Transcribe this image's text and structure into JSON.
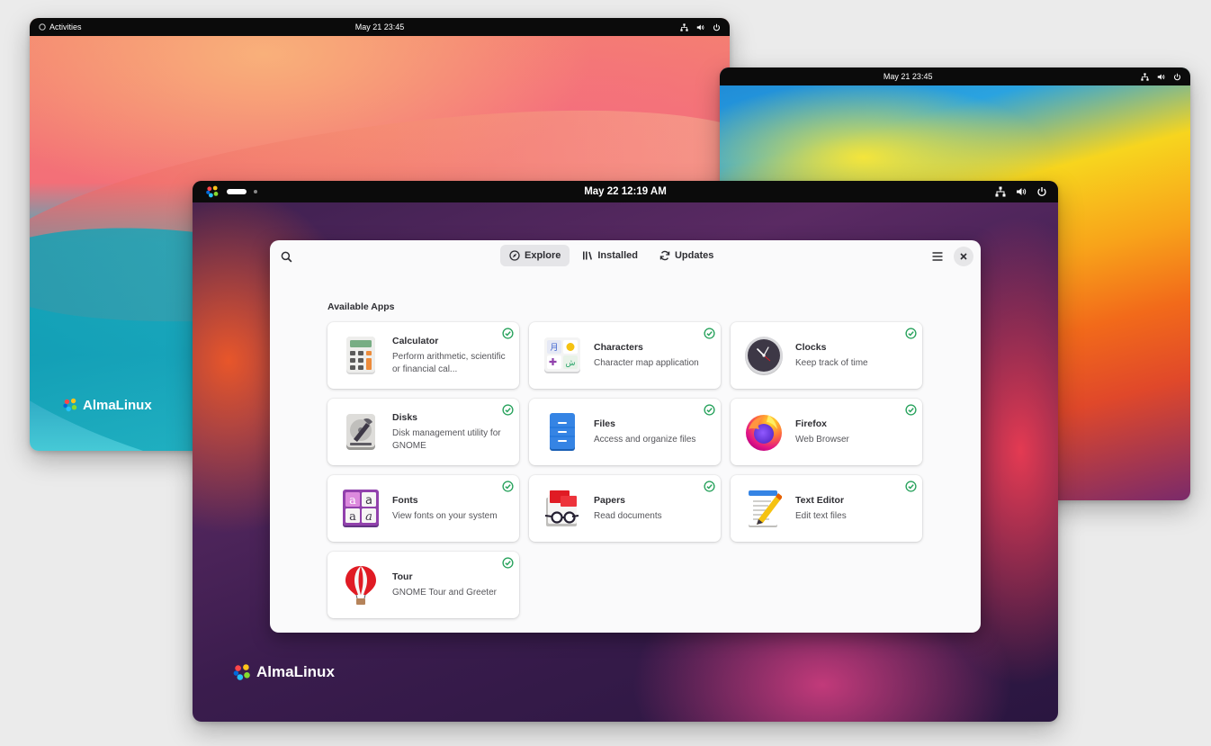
{
  "screens": {
    "left": {
      "activities_label": "Activities",
      "clock": "May 21  23:45",
      "logo_text": "AlmaLinux"
    },
    "right": {
      "clock": "May 21  23:45"
    },
    "main": {
      "clock": "May 22  12:19 AM",
      "logo_text": "AlmaLinux"
    }
  },
  "software": {
    "tabs": [
      {
        "label": "Explore",
        "icon": "compass-icon",
        "active": true
      },
      {
        "label": "Installed",
        "icon": "library-icon",
        "active": false
      },
      {
        "label": "Updates",
        "icon": "refresh-icon",
        "active": false
      }
    ],
    "section_title": "Available Apps",
    "apps": [
      {
        "name": "Calculator",
        "desc": "Perform arithmetic, scientific or financial cal...",
        "icon": "calculator-icon",
        "installed": true
      },
      {
        "name": "Characters",
        "desc": "Character map application",
        "icon": "characters-icon",
        "installed": true
      },
      {
        "name": "Clocks",
        "desc": "Keep track of time",
        "icon": "clock-icon",
        "installed": true
      },
      {
        "name": "Disks",
        "desc": "Disk management utility for GNOME",
        "icon": "disks-icon",
        "installed": true
      },
      {
        "name": "Files",
        "desc": "Access and organize files",
        "icon": "files-icon",
        "installed": true
      },
      {
        "name": "Firefox",
        "desc": "Web Browser",
        "icon": "firefox-icon",
        "installed": true
      },
      {
        "name": "Fonts",
        "desc": "View fonts on your system",
        "icon": "fonts-icon",
        "installed": true
      },
      {
        "name": "Papers",
        "desc": "Read documents",
        "icon": "papers-icon",
        "installed": true
      },
      {
        "name": "Text Editor",
        "desc": "Edit text files",
        "icon": "text-editor-icon",
        "installed": true
      },
      {
        "name": "Tour",
        "desc": "GNOME Tour and Greeter",
        "icon": "balloon-icon",
        "installed": true
      }
    ]
  },
  "colors": {
    "check_green": "#2aa35e",
    "accent_text": "#2e2e33"
  }
}
